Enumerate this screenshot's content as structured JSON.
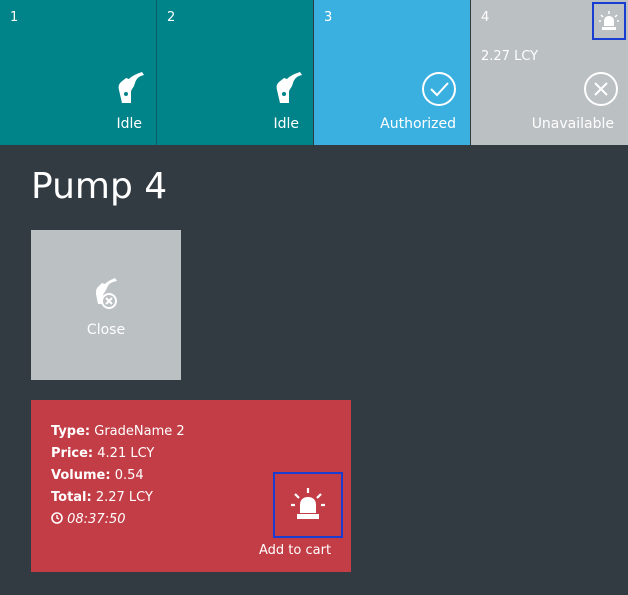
{
  "pumps": [
    {
      "number": "1",
      "status": "Idle",
      "icon": "fuel-nozzle-icon"
    },
    {
      "number": "2",
      "status": "Idle",
      "icon": "fuel-nozzle-icon"
    },
    {
      "number": "3",
      "status": "Authorized",
      "icon": "check-circle-icon"
    },
    {
      "number": "4",
      "status": "Unavailable",
      "amount": "2.27 LCY",
      "icon": "x-circle-icon"
    }
  ],
  "page": {
    "title": "Pump 4"
  },
  "close_tile": {
    "label": "Close",
    "icon": "fuel-nozzle-x-icon"
  },
  "transaction": {
    "type_label": "Type:",
    "type_value": "GradeName 2",
    "price_label": "Price:",
    "price_value": "4.21 LCY",
    "volume_label": "Volume:",
    "volume_value": "0.54",
    "total_label": "Total:",
    "total_value": "2.27 LCY",
    "time": "08:37:50",
    "add_to_cart": "Add to cart"
  },
  "colors": {
    "idle": "#00848a",
    "authorized": "#3ab0e0",
    "unavailable": "#bbc0c2",
    "background": "#333b42",
    "transaction": "#c33d46",
    "highlight": "#1a3dd1"
  }
}
